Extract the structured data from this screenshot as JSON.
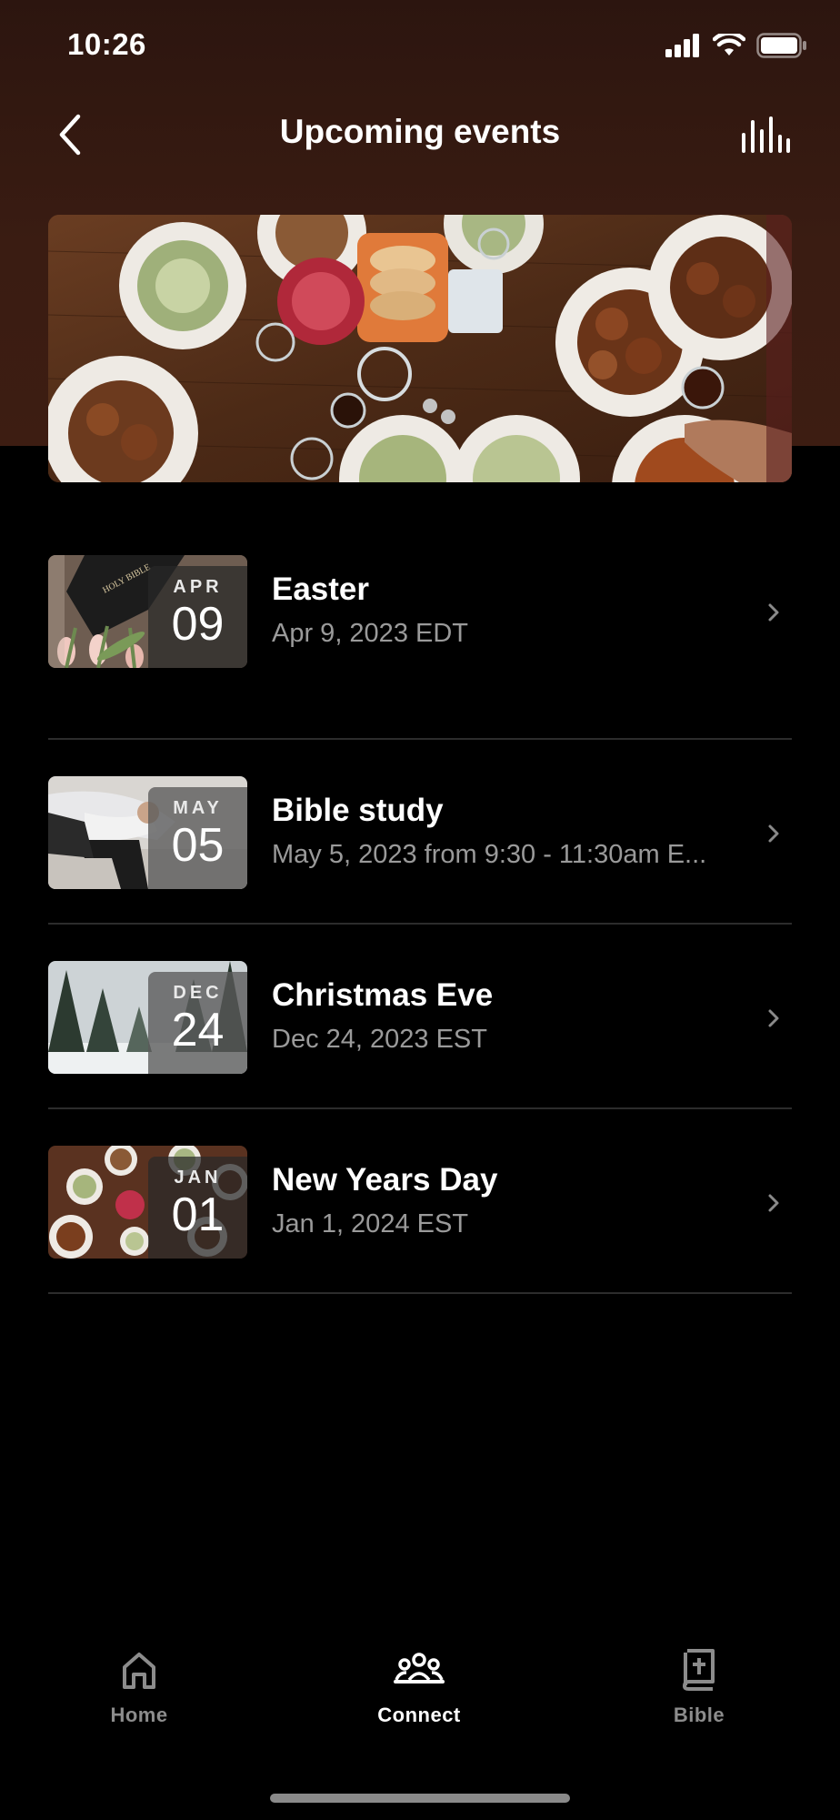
{
  "status_bar": {
    "time": "10:26"
  },
  "header": {
    "title": "Upcoming events",
    "back_icon": "chevron-left-icon",
    "action_icon": "bar-chart-icon"
  },
  "hero": {
    "image": "table-with-food-photo"
  },
  "events": [
    {
      "month": "APR",
      "day": "09",
      "title": "Easter",
      "subtitle": "Apr 9, 2023 EDT",
      "thumb": "bible-and-tulips-photo"
    },
    {
      "month": "MAY",
      "day": "05",
      "title": "Bible study",
      "subtitle": "May 5, 2023 from 9:30 - 11:30am E...",
      "thumb": "person-sitting-photo"
    },
    {
      "month": "DEC",
      "day": "24",
      "title": "Christmas Eve",
      "subtitle": "Dec 24, 2023 EST",
      "thumb": "snowy-forest-photo"
    },
    {
      "month": "JAN",
      "day": "01",
      "title": "New Years Day",
      "subtitle": "Jan 1, 2024 EST",
      "thumb": "table-with-food-photo"
    }
  ],
  "tabbar": {
    "tabs": [
      {
        "label": "Home",
        "icon": "home-icon",
        "active": false
      },
      {
        "label": "Connect",
        "icon": "people-icon",
        "active": true
      },
      {
        "label": "Bible",
        "icon": "bible-icon",
        "active": false
      }
    ]
  },
  "colors": {
    "background": "#000000",
    "header_gradient_top": "#2c150f",
    "header_gradient_bottom": "#3d1d12",
    "subtitle_text": "#9a9a9a",
    "inactive_tab": "#8c8c8c",
    "active_tab": "#ffffff"
  }
}
